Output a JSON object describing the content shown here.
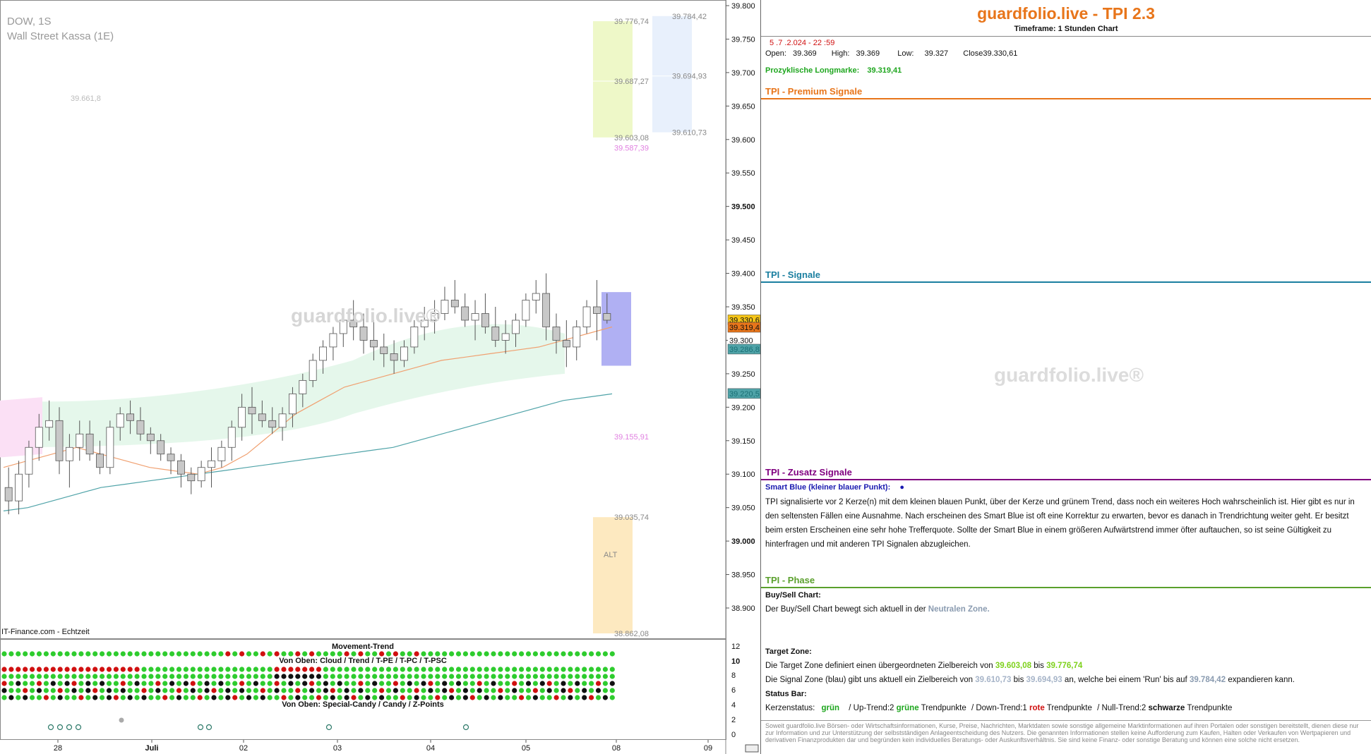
{
  "chart_meta": {
    "symbol": "DOW, 1S",
    "instrument": "Wall Street Kassa (1E)",
    "source": "IT-Finance.com - Echtzeit",
    "watermark": "guardfolio.live®"
  },
  "chart_data": [
    {
      "type": "line",
      "y_axis": {
        "min": 38850,
        "max": 39800,
        "ticks": [
          "39.800",
          "39.750",
          "39.700",
          "39.650",
          "39.600",
          "39.550",
          "39.500",
          "39.450",
          "39.400",
          "39.350",
          "39.300",
          "39.250",
          "39.200",
          "39.150",
          "39.100",
          "39.050",
          "39.000",
          "38.950",
          "38.900"
        ]
      },
      "x_axis": {
        "ticks": [
          "28",
          "Juli",
          "02",
          "03",
          "04",
          "05",
          "08",
          "09"
        ]
      },
      "candles": [
        [
          39080,
          39110,
          39040,
          39060
        ],
        [
          39060,
          39120,
          39040,
          39100
        ],
        [
          39100,
          39150,
          39080,
          39140
        ],
        [
          39140,
          39190,
          39120,
          39170
        ],
        [
          39170,
          39210,
          39150,
          39180
        ],
        [
          39180,
          39200,
          39100,
          39120
        ],
        [
          39120,
          39160,
          39080,
          39140
        ],
        [
          39140,
          39180,
          39120,
          39160
        ],
        [
          39160,
          39180,
          39120,
          39130
        ],
        [
          39130,
          39150,
          39100,
          39110
        ],
        [
          39110,
          39180,
          39100,
          39170
        ],
        [
          39170,
          39200,
          39150,
          39190
        ],
        [
          39190,
          39210,
          39160,
          39180
        ],
        [
          39180,
          39200,
          39150,
          39160
        ],
        [
          39160,
          39170,
          39130,
          39150
        ],
        [
          39150,
          39160,
          39120,
          39130
        ],
        [
          39130,
          39140,
          39100,
          39120
        ],
        [
          39120,
          39130,
          39080,
          39100
        ],
        [
          39100,
          39110,
          39070,
          39090
        ],
        [
          39090,
          39120,
          39080,
          39110
        ],
        [
          39110,
          39140,
          39080,
          39120
        ],
        [
          39120,
          39150,
          39110,
          39140
        ],
        [
          39140,
          39180,
          39120,
          39170
        ],
        [
          39170,
          39220,
          39150,
          39200
        ],
        [
          39200,
          39230,
          39160,
          39190
        ],
        [
          39190,
          39210,
          39170,
          39180
        ],
        [
          39180,
          39200,
          39160,
          39170
        ],
        [
          39170,
          39200,
          39150,
          39190
        ],
        [
          39190,
          39230,
          39170,
          39220
        ],
        [
          39220,
          39250,
          39200,
          39240
        ],
        [
          39240,
          39280,
          39230,
          39270
        ],
        [
          39270,
          39300,
          39250,
          39290
        ],
        [
          39290,
          39320,
          39270,
          39310
        ],
        [
          39310,
          39340,
          39290,
          39330
        ],
        [
          39330,
          39360,
          39300,
          39320
        ],
        [
          39320,
          39340,
          39280,
          39300
        ],
        [
          39300,
          39330,
          39270,
          39290
        ],
        [
          39290,
          39310,
          39260,
          39280
        ],
        [
          39280,
          39300,
          39250,
          39270
        ],
        [
          39270,
          39300,
          39260,
          39290
        ],
        [
          39290,
          39330,
          39280,
          39320
        ],
        [
          39320,
          39350,
          39300,
          39330
        ],
        [
          39330,
          39360,
          39310,
          39340
        ],
        [
          39340,
          39380,
          39330,
          39360
        ],
        [
          39360,
          39390,
          39340,
          39350
        ],
        [
          39350,
          39370,
          39320,
          39330
        ],
        [
          39330,
          39360,
          39300,
          39340
        ],
        [
          39340,
          39370,
          39310,
          39320
        ],
        [
          39320,
          39350,
          39290,
          39300
        ],
        [
          39300,
          39330,
          39280,
          39310
        ],
        [
          39310,
          39340,
          39290,
          39330
        ],
        [
          39330,
          39370,
          39320,
          39360
        ],
        [
          39360,
          39390,
          39340,
          39370
        ],
        [
          39370,
          39400,
          39300,
          39320
        ],
        [
          39320,
          39340,
          39280,
          39300
        ],
        [
          39300,
          39330,
          39260,
          39290
        ],
        [
          39290,
          39330,
          39270,
          39320
        ],
        [
          39320,
          39360,
          39310,
          39350
        ],
        [
          39350,
          39390,
          39300,
          39340
        ],
        [
          39340,
          39370,
          39325,
          39330
        ]
      ],
      "series": [
        {
          "name": "",
          "color": "#4fa3a8",
          "values": [
            39045,
            39050,
            39060,
            39070,
            39080,
            39085,
            39090,
            39095,
            39100,
            39105,
            39110,
            39115,
            39120,
            39125,
            39130,
            39135,
            39140,
            39150,
            39160,
            39170,
            39180,
            39190,
            39200,
            39210,
            39215,
            39220
          ]
        },
        {
          "name": "",
          "color": "#f0a070",
          "values": [
            39110,
            39120,
            39130,
            39140,
            39130,
            39120,
            39110,
            39105,
            39100,
            39110,
            39130,
            39160,
            39190,
            39210,
            39230,
            39240,
            39250,
            39260,
            39270,
            39275,
            39280,
            39285,
            39290,
            39300,
            39310,
            39320
          ]
        }
      ],
      "price_labels": [
        {
          "value": 39330.6,
          "text": "39.330,6",
          "color": "#f5c518"
        },
        {
          "value": 39319.4,
          "text": "39.319,4",
          "color": "#e8751a"
        },
        {
          "value": 39300,
          "text": "39.300",
          "color": "#ffffff"
        },
        {
          "value": 39286.8,
          "text": "39.286,8",
          "color": "#4fa3a8"
        },
        {
          "value": 39220.5,
          "text": "39.220,5",
          "color": "#4fa3a8"
        }
      ],
      "zones": [
        {
          "name": "target",
          "from": 39603.08,
          "to": 39776.74,
          "mid": 39687.27,
          "color": "#eef8c8"
        },
        {
          "name": "signal",
          "from": 39610.73,
          "to": 39784.42,
          "mid": 39694.93,
          "color": "#e8f0fc"
        },
        {
          "name": "alt",
          "from": 38862.08,
          "to": 39035.74,
          "color": "#fde9c0"
        }
      ],
      "annotations": [
        {
          "text": "39.776,74",
          "value": 39776.74,
          "color": "#888888"
        },
        {
          "text": "39.687,27",
          "value": 39687.27,
          "color": "#888888"
        },
        {
          "text": "39.603,08",
          "value": 39603.08,
          "color": "#888888"
        },
        {
          "text": "39.587,39",
          "value": 39587.39,
          "color": "#e080e0"
        },
        {
          "text": "39.784,42",
          "value": 39784.42,
          "color": "#888888"
        },
        {
          "text": "39.694,93",
          "value": 39694.93,
          "color": "#888888"
        },
        {
          "text": "39.610,73",
          "value": 39610.73,
          "color": "#888888"
        },
        {
          "text": "39.155,91",
          "value": 39155.91,
          "color": "#e080e0"
        },
        {
          "text": "39.035,74",
          "value": 39035.74,
          "color": "#888888"
        },
        {
          "text": "38.862,08",
          "value": 38862.08,
          "color": "#888888"
        },
        {
          "text": "39.661,8",
          "value": 39661.8,
          "color": "#bbbbbb"
        },
        {
          "text": "ALT",
          "value": 38980,
          "color": "#888888"
        }
      ]
    }
  ],
  "indicator": {
    "title": "Movement-Trend",
    "row1_label": "Von Oben: Cloud / Trend / T-PE / T-PC / T-PSC",
    "row2_label": "Von Oben: Special-Candy / Candy / Z-Points",
    "axis": [
      "12",
      "10",
      "8",
      "6",
      "4",
      "2",
      "0"
    ]
  },
  "panel": {
    "title": "guardfolio.live - TPI 2.3",
    "timeframe": "Timeframe: 1 Stunden Chart",
    "datetime": "5 .7 .2.024  - 22 :59",
    "ohlc": {
      "open_label": "Open:",
      "open": "39.369",
      "high_label": "High:",
      "high": "39.369",
      "low_label": "Low:",
      "low": "39.327",
      "close_label": "Close",
      "close": "39.330,61"
    },
    "longmark_label": "Prozyklische Longmarke:",
    "longmark": "39.319,41",
    "premium_title": "TPI - Premium Signale",
    "signals_title": "TPI - Signale",
    "watermark": "guardfolio.live®",
    "zusatz_title": "TPI - Zusatz Signale",
    "smart_blue_label": "Smart Blue (kleiner blauer Punkt):",
    "smart_blue_text": "TPI signalisierte vor 2  Kerze(n) mit dem kleinen blauen Punkt, über der Kerze und grünem Trend, dass noch ein weiteres Hoch wahrscheinlich ist. Hier gibt es nur in den seltensten Fällen eine Ausnahme. Nach erscheinen des Smart Blue ist oft eine Korrektur zu erwarten, bevor es danach in Trendrichtung weiter geht. Er besitzt beim ersten Erscheinen eine sehr hohe Trefferquote. Sollte der Smart Blue in einem größeren Aufwärtstrend immer öfter auftauchen, so ist seine Gültigkeit zu hinterfragen und mit anderen TPI Signalen abzugleichen.",
    "phase_title": "TPI - Phase",
    "buysell_label": "Buy/Sell Chart:",
    "buysell_text": "Der Buy/Sell Chart bewegt sich aktuell in der",
    "buysell_zone": "Neutralen Zone.",
    "target_label": "Target Zone:",
    "target_text1": "Die Target Zone definiert einen übergeordneten Zielbereich von",
    "target_from": "39.603,08",
    "target_bis": "bis",
    "target_to": "39.776,74",
    "signal_text1": "Die Signal Zone (blau) gibt uns aktuell ein Zielbereich von",
    "signal_from": "39.610,73",
    "signal_bis": "bis",
    "signal_to": "39.694,93",
    "signal_text2": "an, welche bei einem 'Run' bis auf",
    "signal_run": "39.784,42",
    "signal_text3": "expandieren kann.",
    "status_label": "Status Bar:",
    "kerzen_label": "Kerzenstatus:",
    "kerzen_value": "grün",
    "up_text": "/ Up-Trend:2",
    "up_word": "grüne",
    "up_tail": "Trendpunkte",
    "down_text": "/ Down-Trend:1",
    "down_word": "rote",
    "down_tail": "Trendpunkte",
    "null_text": "/ Null-Trend:2",
    "null_word": "schwarze",
    "null_tail": "Trendpunkte",
    "disclaimer": "Soweit guardfolio.live Börsen- oder Wirtschaftsinformationen, Kurse, Preise, Nachrichten, Marktdaten sowie sonstige allgemeine Marktinformationen auf ihren Portalen oder sonstigen bereitstellt, dienen diese nur zur Information und zur Unterstützung der selbstständigen Anlageentscheidung des Nutzers. Die genannten Informationen stellen keine Aufforderung zum Kaufen, Halten oder Verkaufen von Wertpapieren und derivativen Finanzprodukten dar und begründen kein individuelles Beratungs- oder Auskunftsverhältnis. Sie sind keine Finanz- oder sonstige Beratung und können eine solche nicht ersetzen."
  }
}
